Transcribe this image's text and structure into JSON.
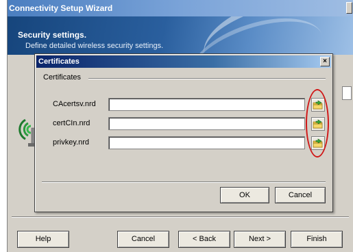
{
  "wizard": {
    "title": "Connectivity Setup Wizard",
    "header_title": "Security settings.",
    "header_subtitle": "Define detailed wireless security settings.",
    "buttons": {
      "help": "Help",
      "cancel": "Cancel",
      "back": "< Back",
      "next": "Next >",
      "finish": "Finish"
    }
  },
  "dialog": {
    "title": "Certificates",
    "close_glyph": "×",
    "group_label": "Certificates",
    "fields": [
      {
        "label": "CAcertsv.nrd",
        "value": ""
      },
      {
        "label": "certCIn.nrd",
        "value": ""
      },
      {
        "label": "privkey.nrd",
        "value": ""
      }
    ],
    "browse_icon": "folder-browse-icon",
    "buttons": {
      "ok": "OK",
      "cancel": "Cancel"
    }
  },
  "colors": {
    "highlight": "#d01818",
    "title_bar": "#0a246a"
  }
}
